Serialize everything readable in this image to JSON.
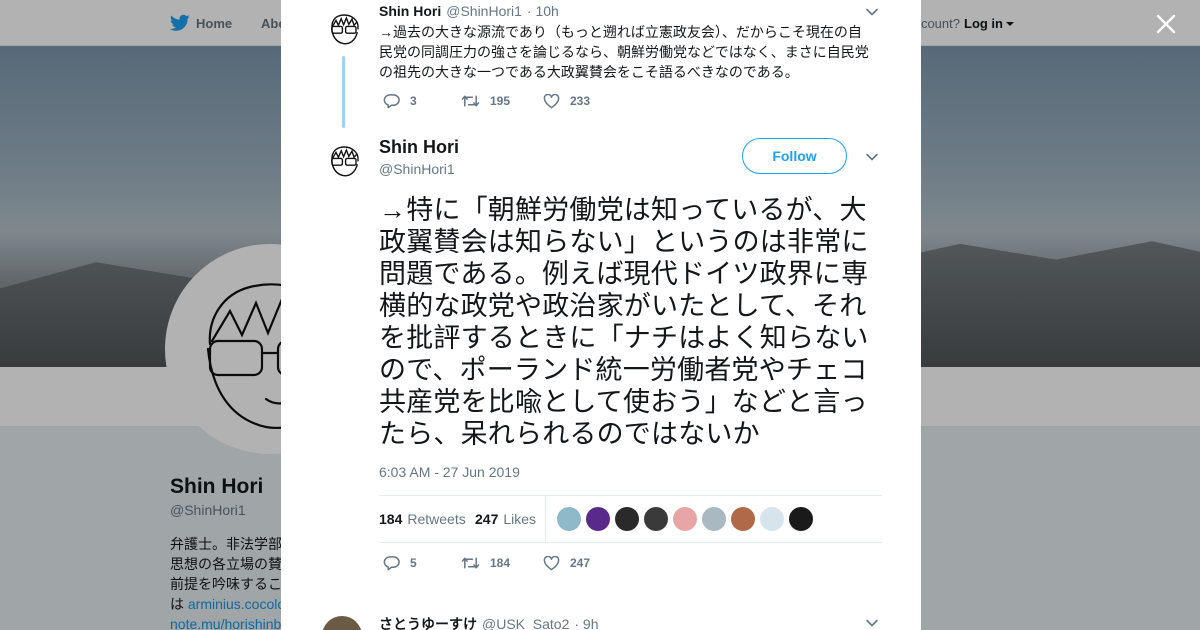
{
  "nav": {
    "home": "Home",
    "about": "Abo",
    "account_prompt": "ccount?",
    "login": "Log in"
  },
  "profile": {
    "name": "Shin Hori",
    "handle": "@ShinHori1",
    "bio_lines": [
      "弁護士。非法学部",
      "思想の各立場の賛",
      "前提を吟味するこ",
      "は "
    ],
    "bio_link1": "arminius.cocolo",
    "bio_link2": "note.mu/horishinb"
  },
  "parent_tweet": {
    "name": "Shin Hori",
    "handle": "@ShinHori1",
    "time": "· 10h",
    "text": "→過去の大きな源流であり（もっと遡れば立憲政友会）、だからこそ現在の自民党の同調圧力の強さを論じるなら、朝鮮労働党などではなく、まさに自民党の祖先の大きな一つである大政翼賛会をこそ語るべきなのである。",
    "replies": "3",
    "retweets": "195",
    "likes": "233"
  },
  "main_tweet": {
    "name": "Shin Hori",
    "handle": "@ShinHori1",
    "follow_label": "Follow",
    "text": "→特に「朝鮮労働党は知っているが、大政翼賛会は知らない」というのは非常に問題である。例えば現代ドイツ政界に専横的な政党や政治家がいたとして、それを批評するときに「ナチはよく知らないので、ポーランド統一労働者党やチェコ共産党を比喩として使おう」などと言ったら、呆れられるのではないか",
    "timestamp": "6:03 AM - 27 Jun 2019",
    "retweet_count": "184",
    "retweet_label": "Retweets",
    "like_count": "247",
    "like_label": "Likes",
    "replies": "5",
    "retweets": "184",
    "likes": "247",
    "liker_colors": [
      "#8fb8c9",
      "#5a2a8a",
      "#2a2a2a",
      "#3a3a3a",
      "#e8a5a5",
      "#aab8c2",
      "#b06a4a",
      "#d8e4ec",
      "#1a1a1a"
    ]
  },
  "next_reply": {
    "name": "さとうゆーすけ",
    "handle": "@USK_Sato2",
    "time": "· 9h"
  },
  "colors": {
    "brand": "#1da1f2",
    "thread": "#9cd4f5",
    "muted": "#657786"
  }
}
